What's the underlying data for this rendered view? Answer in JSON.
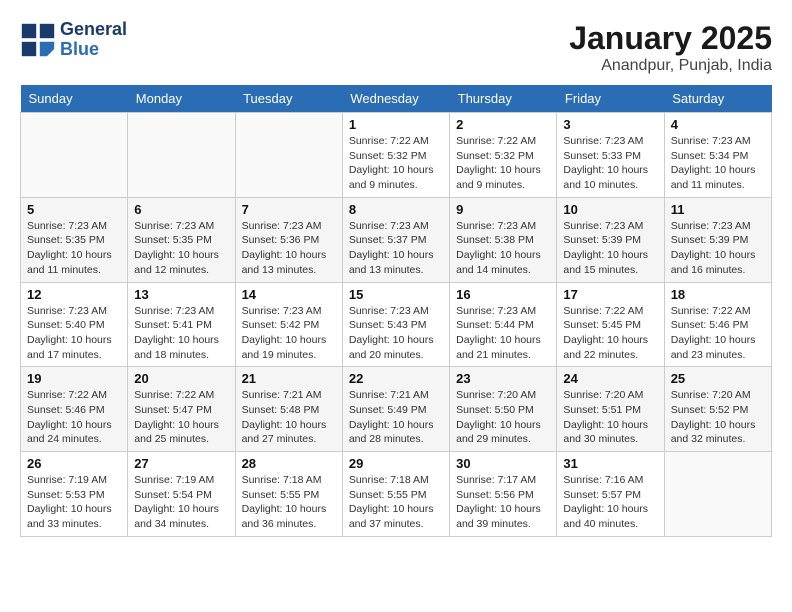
{
  "header": {
    "logo_line1": "General",
    "logo_line2": "Blue",
    "month": "January 2025",
    "location": "Anandpur, Punjab, India"
  },
  "weekdays": [
    "Sunday",
    "Monday",
    "Tuesday",
    "Wednesday",
    "Thursday",
    "Friday",
    "Saturday"
  ],
  "weeks": [
    [
      {
        "day": "",
        "info": ""
      },
      {
        "day": "",
        "info": ""
      },
      {
        "day": "",
        "info": ""
      },
      {
        "day": "1",
        "info": "Sunrise: 7:22 AM\nSunset: 5:32 PM\nDaylight: 10 hours\nand 9 minutes."
      },
      {
        "day": "2",
        "info": "Sunrise: 7:22 AM\nSunset: 5:32 PM\nDaylight: 10 hours\nand 9 minutes."
      },
      {
        "day": "3",
        "info": "Sunrise: 7:23 AM\nSunset: 5:33 PM\nDaylight: 10 hours\nand 10 minutes."
      },
      {
        "day": "4",
        "info": "Sunrise: 7:23 AM\nSunset: 5:34 PM\nDaylight: 10 hours\nand 11 minutes."
      }
    ],
    [
      {
        "day": "5",
        "info": "Sunrise: 7:23 AM\nSunset: 5:35 PM\nDaylight: 10 hours\nand 11 minutes."
      },
      {
        "day": "6",
        "info": "Sunrise: 7:23 AM\nSunset: 5:35 PM\nDaylight: 10 hours\nand 12 minutes."
      },
      {
        "day": "7",
        "info": "Sunrise: 7:23 AM\nSunset: 5:36 PM\nDaylight: 10 hours\nand 13 minutes."
      },
      {
        "day": "8",
        "info": "Sunrise: 7:23 AM\nSunset: 5:37 PM\nDaylight: 10 hours\nand 13 minutes."
      },
      {
        "day": "9",
        "info": "Sunrise: 7:23 AM\nSunset: 5:38 PM\nDaylight: 10 hours\nand 14 minutes."
      },
      {
        "day": "10",
        "info": "Sunrise: 7:23 AM\nSunset: 5:39 PM\nDaylight: 10 hours\nand 15 minutes."
      },
      {
        "day": "11",
        "info": "Sunrise: 7:23 AM\nSunset: 5:39 PM\nDaylight: 10 hours\nand 16 minutes."
      }
    ],
    [
      {
        "day": "12",
        "info": "Sunrise: 7:23 AM\nSunset: 5:40 PM\nDaylight: 10 hours\nand 17 minutes."
      },
      {
        "day": "13",
        "info": "Sunrise: 7:23 AM\nSunset: 5:41 PM\nDaylight: 10 hours\nand 18 minutes."
      },
      {
        "day": "14",
        "info": "Sunrise: 7:23 AM\nSunset: 5:42 PM\nDaylight: 10 hours\nand 19 minutes."
      },
      {
        "day": "15",
        "info": "Sunrise: 7:23 AM\nSunset: 5:43 PM\nDaylight: 10 hours\nand 20 minutes."
      },
      {
        "day": "16",
        "info": "Sunrise: 7:23 AM\nSunset: 5:44 PM\nDaylight: 10 hours\nand 21 minutes."
      },
      {
        "day": "17",
        "info": "Sunrise: 7:22 AM\nSunset: 5:45 PM\nDaylight: 10 hours\nand 22 minutes."
      },
      {
        "day": "18",
        "info": "Sunrise: 7:22 AM\nSunset: 5:46 PM\nDaylight: 10 hours\nand 23 minutes."
      }
    ],
    [
      {
        "day": "19",
        "info": "Sunrise: 7:22 AM\nSunset: 5:46 PM\nDaylight: 10 hours\nand 24 minutes."
      },
      {
        "day": "20",
        "info": "Sunrise: 7:22 AM\nSunset: 5:47 PM\nDaylight: 10 hours\nand 25 minutes."
      },
      {
        "day": "21",
        "info": "Sunrise: 7:21 AM\nSunset: 5:48 PM\nDaylight: 10 hours\nand 27 minutes."
      },
      {
        "day": "22",
        "info": "Sunrise: 7:21 AM\nSunset: 5:49 PM\nDaylight: 10 hours\nand 28 minutes."
      },
      {
        "day": "23",
        "info": "Sunrise: 7:20 AM\nSunset: 5:50 PM\nDaylight: 10 hours\nand 29 minutes."
      },
      {
        "day": "24",
        "info": "Sunrise: 7:20 AM\nSunset: 5:51 PM\nDaylight: 10 hours\nand 30 minutes."
      },
      {
        "day": "25",
        "info": "Sunrise: 7:20 AM\nSunset: 5:52 PM\nDaylight: 10 hours\nand 32 minutes."
      }
    ],
    [
      {
        "day": "26",
        "info": "Sunrise: 7:19 AM\nSunset: 5:53 PM\nDaylight: 10 hours\nand 33 minutes."
      },
      {
        "day": "27",
        "info": "Sunrise: 7:19 AM\nSunset: 5:54 PM\nDaylight: 10 hours\nand 34 minutes."
      },
      {
        "day": "28",
        "info": "Sunrise: 7:18 AM\nSunset: 5:55 PM\nDaylight: 10 hours\nand 36 minutes."
      },
      {
        "day": "29",
        "info": "Sunrise: 7:18 AM\nSunset: 5:55 PM\nDaylight: 10 hours\nand 37 minutes."
      },
      {
        "day": "30",
        "info": "Sunrise: 7:17 AM\nSunset: 5:56 PM\nDaylight: 10 hours\nand 39 minutes."
      },
      {
        "day": "31",
        "info": "Sunrise: 7:16 AM\nSunset: 5:57 PM\nDaylight: 10 hours\nand 40 minutes."
      },
      {
        "day": "",
        "info": ""
      }
    ]
  ]
}
